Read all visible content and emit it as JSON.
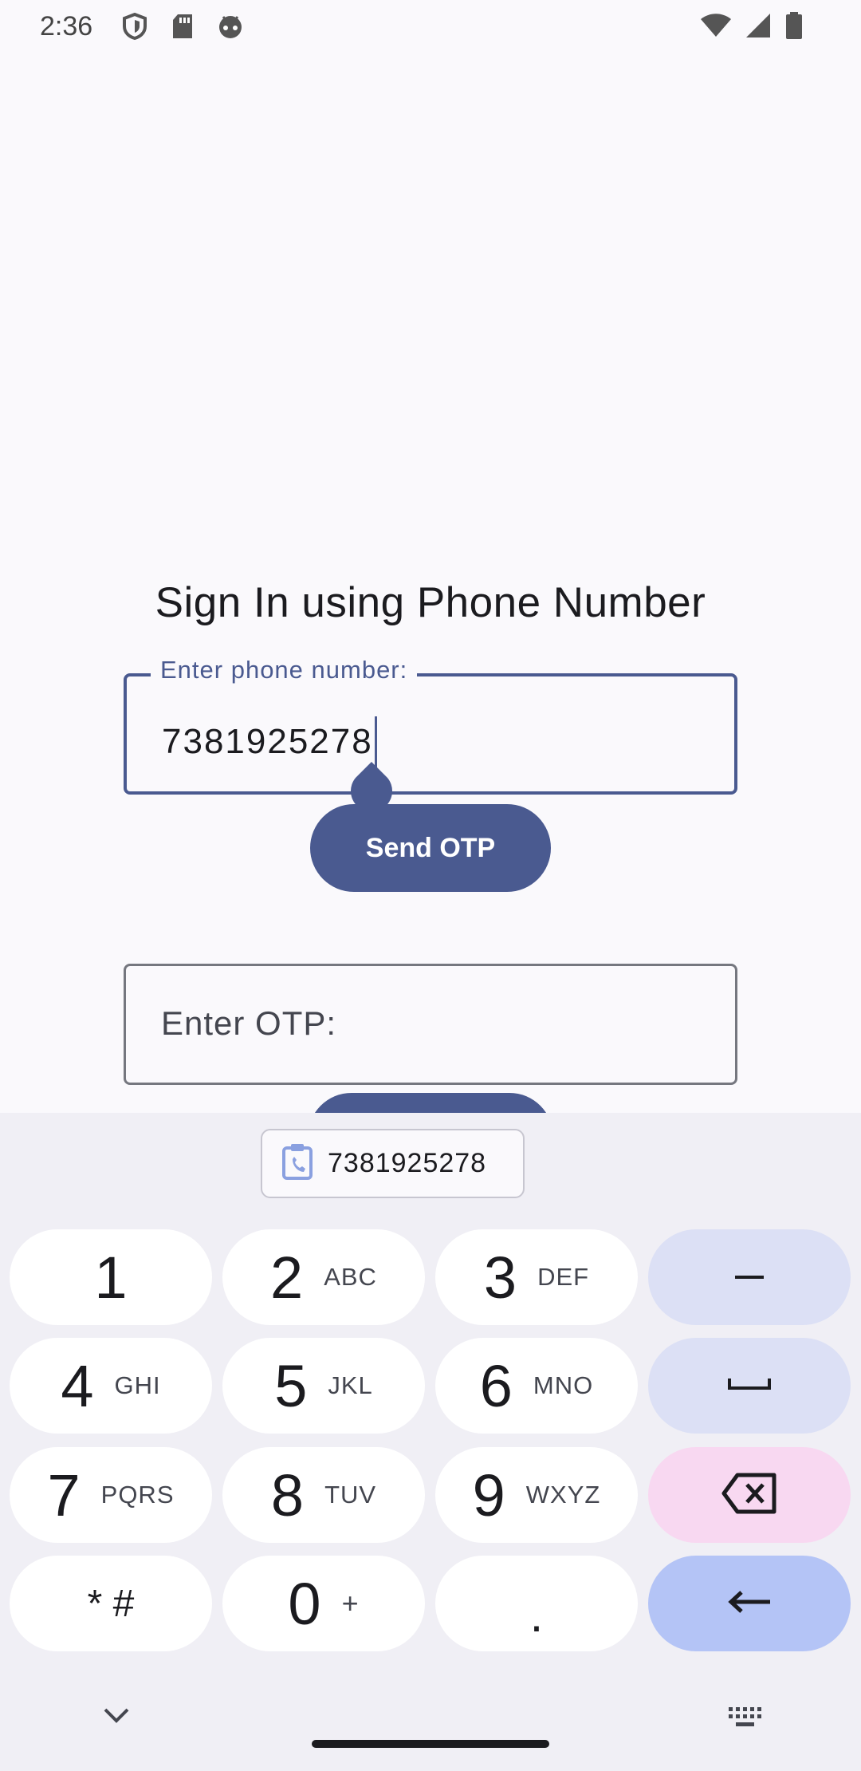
{
  "status_bar": {
    "time": "2:36",
    "icons": [
      "shield-icon",
      "sd-card-icon",
      "android-icon",
      "wifi-icon",
      "signal-icon",
      "battery-icon"
    ]
  },
  "screen": {
    "title": "Sign In using Phone Number",
    "phone_field": {
      "label": "Enter phone number:",
      "value": "7381925278"
    },
    "send_otp_label": "Send OTP",
    "otp_field": {
      "placeholder": "Enter OTP:"
    }
  },
  "keyboard": {
    "clipboard_suggestion": "7381925278",
    "rows": [
      [
        {
          "num": "1",
          "sub": ""
        },
        {
          "num": "2",
          "sub": "ABC"
        },
        {
          "num": "3",
          "sub": "DEF"
        }
      ],
      [
        {
          "num": "4",
          "sub": "GHI"
        },
        {
          "num": "5",
          "sub": "JKL"
        },
        {
          "num": "6",
          "sub": "MNO"
        }
      ],
      [
        {
          "num": "7",
          "sub": "PQRS"
        },
        {
          "num": "8",
          "sub": "TUV"
        },
        {
          "num": "9",
          "sub": "WXYZ"
        }
      ],
      [
        {
          "num": "* #",
          "sub": ""
        },
        {
          "num": "0",
          "sub": "+"
        },
        {
          "num": ".",
          "sub": ""
        }
      ]
    ],
    "function_keys": [
      "minus-icon",
      "space-icon",
      "backspace-icon",
      "enter-icon"
    ]
  },
  "colors": {
    "primary": "#4a5a90",
    "background": "#faf9fc",
    "keyboard_bg": "#f0eff5",
    "fn_key": "#dce0f5",
    "delete_key": "#f8d8f1",
    "enter_key": "#b4c4f6"
  }
}
